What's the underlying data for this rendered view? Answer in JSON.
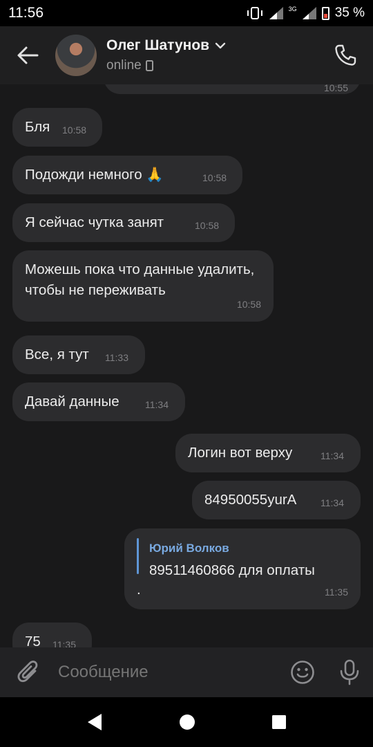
{
  "status_bar": {
    "time": "11:56",
    "network": "3G",
    "battery": "35 %"
  },
  "header": {
    "contact_name": "Олег Шатунов",
    "contact_status": "online"
  },
  "messages": [
    {
      "text": "Бля",
      "time": "10:58",
      "direction": "incoming"
    },
    {
      "text": "Подожди немного 🙏",
      "time": "10:58",
      "direction": "incoming"
    },
    {
      "text": "Я сейчас чутка занят",
      "time": "10:58",
      "direction": "incoming"
    },
    {
      "text": "Можешь пока что данные удалить, чтобы не переживать",
      "time": "10:58",
      "direction": "incoming"
    },
    {
      "text": "Все, я тут",
      "time": "11:33",
      "direction": "incoming"
    },
    {
      "text": "Давай данные",
      "time": "11:34",
      "direction": "incoming"
    },
    {
      "text": "Логин вот верху",
      "time": "11:34",
      "direction": "outgoing"
    },
    {
      "text": "84950055yurA",
      "time": "11:34",
      "direction": "outgoing"
    },
    {
      "reply_author": "Юрий Волков",
      "text": "89511460866 для оплаты",
      "trailing": ".",
      "time": "11:35",
      "direction": "outgoing"
    },
    {
      "text": "75",
      "time": "11:35",
      "direction": "incoming"
    }
  ],
  "previous_bubble_time": "10:55",
  "input": {
    "placeholder": "Сообщение"
  },
  "colors": {
    "background": "#19191a",
    "bubble": "#2c2c2e",
    "accent": "#79a9e0"
  }
}
